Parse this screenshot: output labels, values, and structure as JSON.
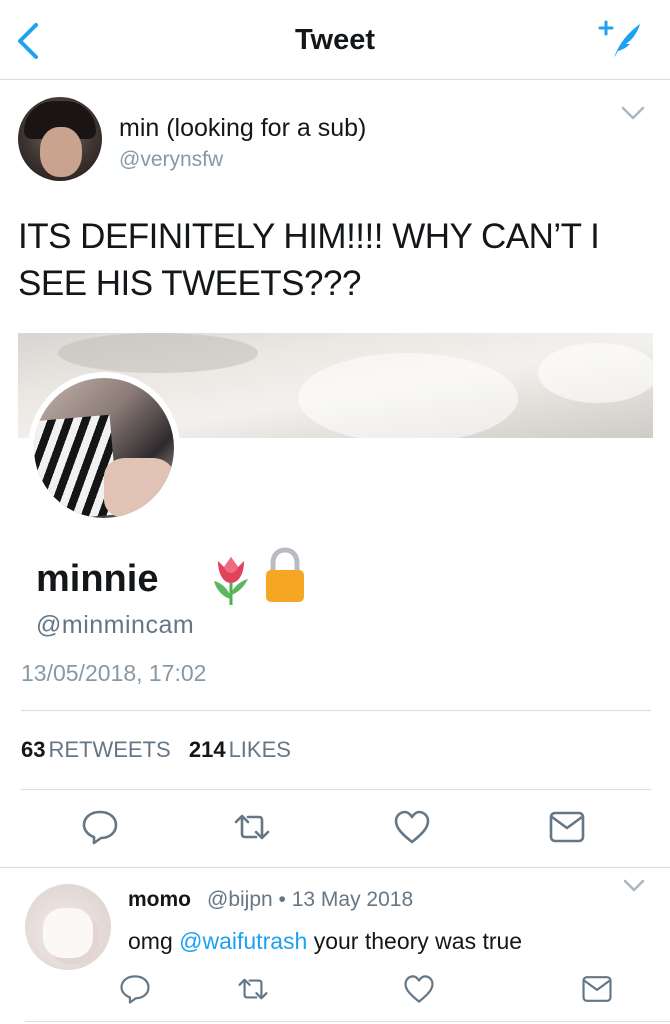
{
  "nav": {
    "title": "Tweet",
    "back_icon": "chevron-left-icon",
    "compose_icon": "compose-tweet-icon",
    "accent": "#1da1f2"
  },
  "tweet": {
    "author_name": "min (looking for a sub)",
    "author_handle": "@verynsfw",
    "text": "ITS DEFINITELY HIM!!!! WHY CAN’T I SEE HIS TWEETS???",
    "embedded_profile": {
      "name": "minnie",
      "handle": "@minmincam",
      "emoji": [
        "tulip-icon",
        "lock-icon"
      ]
    },
    "timestamp": "13/05/2018, 17:02",
    "retweets_count": "63",
    "retweets_label": "RETWEETS",
    "likes_count": "214",
    "likes_label": "LIKES",
    "actions": [
      "reply-icon",
      "retweet-icon",
      "like-icon",
      "dm-icon"
    ]
  },
  "reply": {
    "author_name": "momo",
    "author_handle_date": "@bijpn • 13 May 2018",
    "text_before": "omg ",
    "mention": "@waifutrash",
    "text_after": " your theory was true"
  },
  "colors": {
    "text": "#14171a",
    "secondary": "#657786",
    "muted": "#8899a6",
    "divider": "#d8dde1",
    "lock": "#f5a623"
  }
}
